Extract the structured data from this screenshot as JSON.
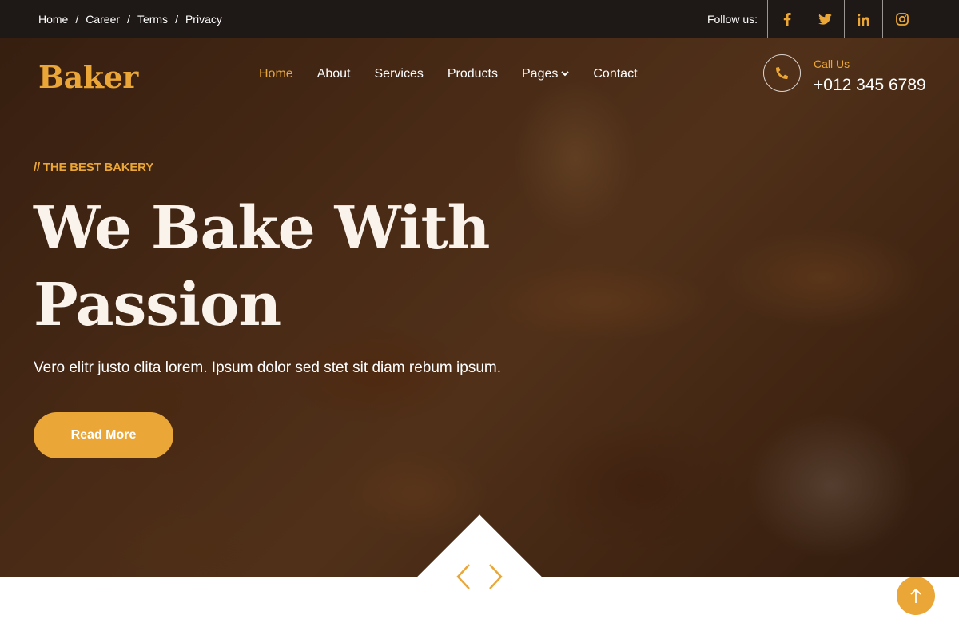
{
  "topbar": {
    "links": [
      "Home",
      "Career",
      "Terms",
      "Privacy"
    ],
    "separator": "/",
    "follow_label": "Follow us:",
    "social_icons": [
      "facebook-icon",
      "twitter-icon",
      "linkedin-icon",
      "instagram-icon"
    ]
  },
  "brand": {
    "name": "Baker"
  },
  "nav": {
    "items": [
      "Home",
      "About",
      "Services",
      "Products",
      "Pages",
      "Contact"
    ],
    "active": "Home"
  },
  "contact": {
    "label": "Call Us",
    "phone": "+012 345 6789"
  },
  "hero": {
    "kicker": "// THE BEST BAKERY",
    "headline_line1": "We Bake With",
    "headline_line2": "Passion",
    "lead": "Vero elitr justo clita lorem. Ipsum dolor sed stet sit diam rebum ipsum.",
    "button": "Read More"
  },
  "colors": {
    "accent": "#eaa636",
    "topbar": "#1e1816",
    "text_light": "#faf3ec"
  }
}
